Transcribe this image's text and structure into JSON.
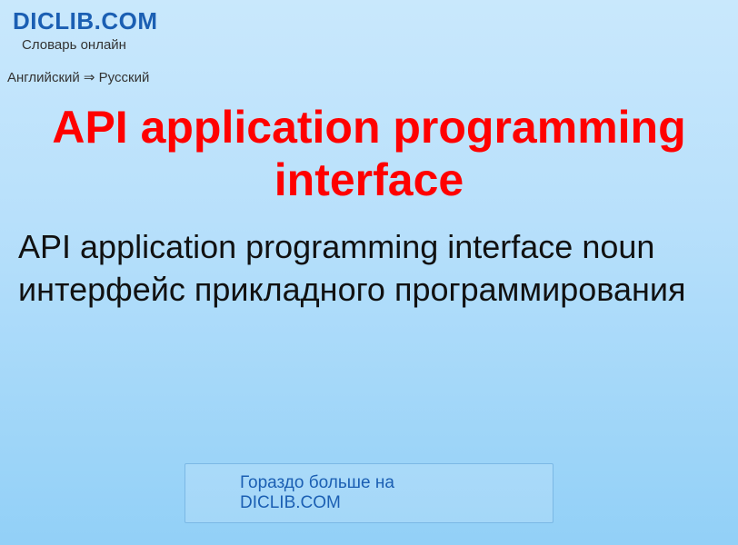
{
  "header": {
    "site_name": "DICLIB.COM",
    "tagline": "Словарь онлайн"
  },
  "breadcrumb": {
    "text": "Английский ⇒ Русский"
  },
  "entry": {
    "title": "API application programming interface",
    "definition": "API application programming interface noun интерфейс прикладного программирования"
  },
  "footer": {
    "more_link": "Гораздо больше на DICLIB.COM"
  }
}
